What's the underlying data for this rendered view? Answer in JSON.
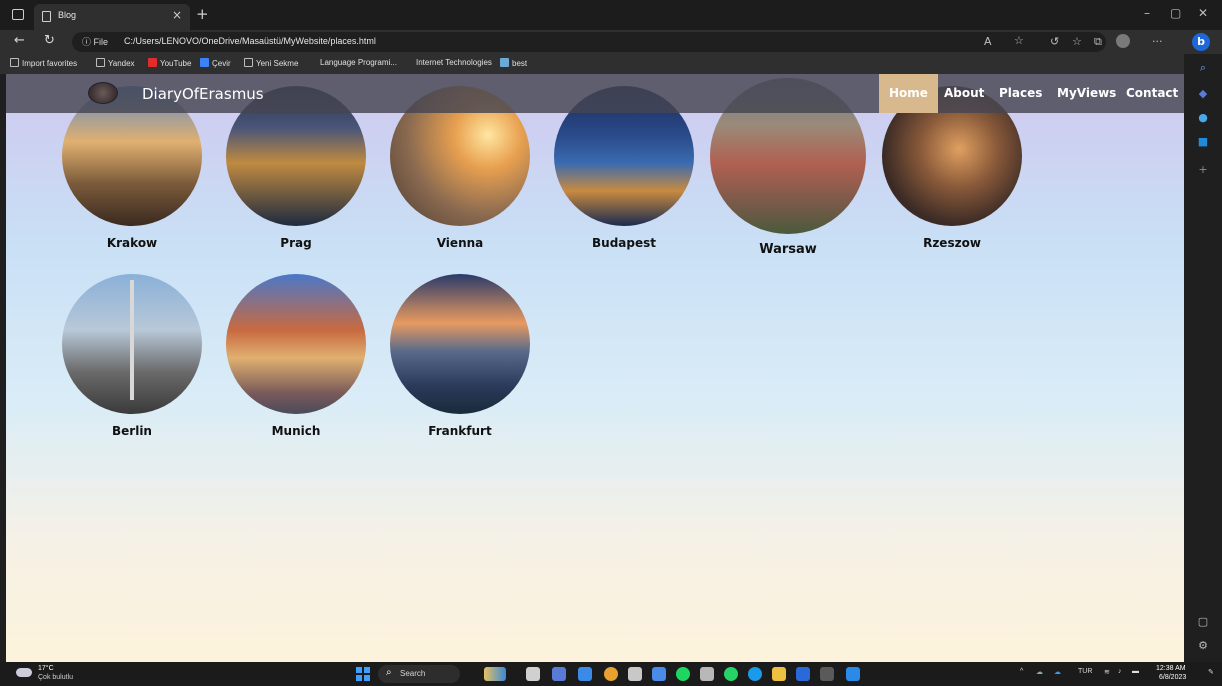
{
  "browser": {
    "tab_title": "Blog",
    "tab_close": "×",
    "new_tab": "+",
    "url_info": "ⓘ File",
    "url": "C:/Users/LENOVO/OneDrive/Masaüstü/MyWebsite/places.html",
    "window_controls": [
      "–",
      "▢",
      "✕"
    ],
    "favorites": [
      {
        "label": "Import favorites",
        "color": "#bdbdbd"
      },
      {
        "label": "Yandex",
        "color": "#bdbdbd"
      },
      {
        "label": "YouTube",
        "color": "#e32b2b"
      },
      {
        "label": "Çevir",
        "color": "#3b82f6"
      },
      {
        "label": "Yeni Sekme",
        "color": "#bdbdbd"
      },
      {
        "label": "Language Programi...",
        "color": "#2f2f2f"
      },
      {
        "label": "Internet Technologies",
        "color": "#2f2f2f"
      },
      {
        "label": "best",
        "color": "#6aa9d8"
      }
    ]
  },
  "site": {
    "brand": "DiaryOfErasmus",
    "nav": [
      "Home",
      "About",
      "Places",
      "MyViews",
      "Contact"
    ],
    "active_nav": "Home",
    "active_color": "#d8b98d",
    "places": [
      {
        "name": "Krakow"
      },
      {
        "name": "Prag"
      },
      {
        "name": "Vienna"
      },
      {
        "name": "Budapest"
      },
      {
        "name": "Warsaw"
      },
      {
        "name": "Rzeszow"
      },
      {
        "name": "Berlin"
      },
      {
        "name": "Munich"
      },
      {
        "name": "Frankfurt"
      }
    ]
  },
  "taskbar": {
    "weather_temp": "17°C",
    "weather_desc": "Çok bulutlu",
    "search_label": "Search",
    "language": "TUR",
    "time": "12:38 AM",
    "date": "6/8/2023"
  }
}
